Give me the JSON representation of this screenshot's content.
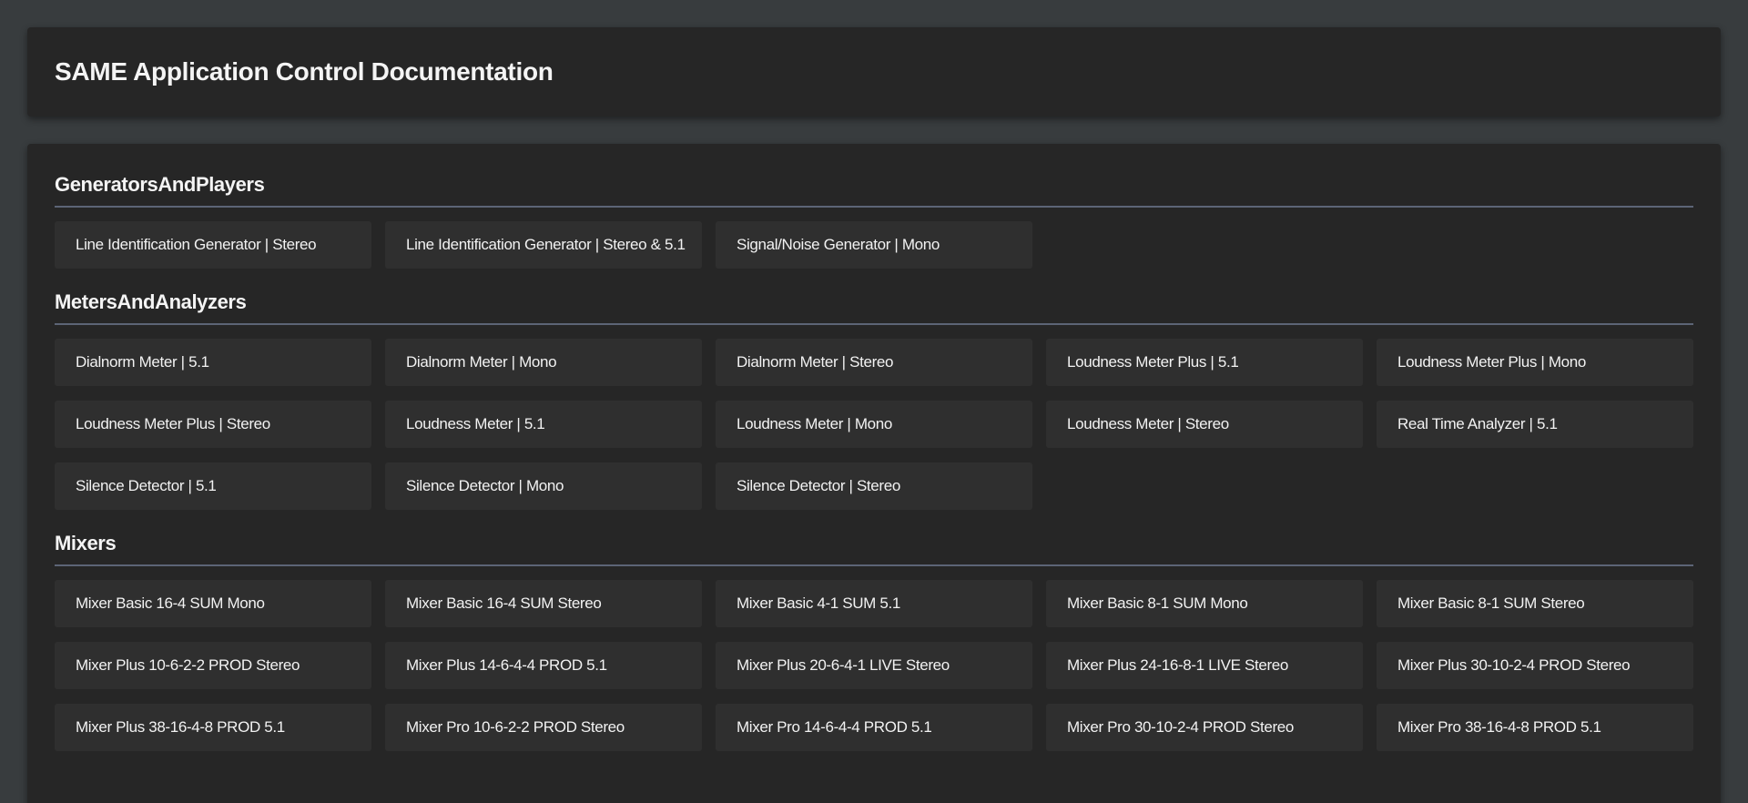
{
  "header": {
    "title": "SAME Application Control Documentation"
  },
  "sections": [
    {
      "title": "GeneratorsAndPlayers",
      "items": [
        "Line Identification Generator | Stereo",
        "Line Identification Generator | Stereo & 5.1",
        "Signal/Noise Generator | Mono"
      ]
    },
    {
      "title": "MetersAndAnalyzers",
      "items": [
        "Dialnorm Meter | 5.1",
        "Dialnorm Meter | Mono",
        "Dialnorm Meter | Stereo",
        "Loudness Meter Plus | 5.1",
        "Loudness Meter Plus | Mono",
        "Loudness Meter Plus | Stereo",
        "Loudness Meter | 5.1",
        "Loudness Meter | Mono",
        "Loudness Meter | Stereo",
        "Real Time Analyzer | 5.1",
        "Silence Detector | 5.1",
        "Silence Detector | Mono",
        "Silence Detector | Stereo"
      ]
    },
    {
      "title": "Mixers",
      "items": [
        "Mixer Basic 16-4 SUM Mono",
        "Mixer Basic 16-4 SUM Stereo",
        "Mixer Basic 4-1 SUM 5.1",
        "Mixer Basic 8-1 SUM Mono",
        "Mixer Basic 8-1 SUM Stereo",
        "Mixer Plus 10-6-2-2 PROD Stereo",
        "Mixer Plus 14-6-4-4 PROD 5.1",
        "Mixer Plus 20-6-4-1 LIVE Stereo",
        "Mixer Plus 24-16-8-1 LIVE Stereo",
        "Mixer Plus 30-10-2-4 PROD Stereo",
        "Mixer Plus 38-16-4-8 PROD 5.1",
        "Mixer Pro 10-6-2-2 PROD Stereo",
        "Mixer Pro 14-6-4-4 PROD 5.1",
        "Mixer Pro 30-10-2-4 PROD Stereo",
        "Mixer Pro 38-16-4-8 PROD 5.1"
      ]
    }
  ]
}
